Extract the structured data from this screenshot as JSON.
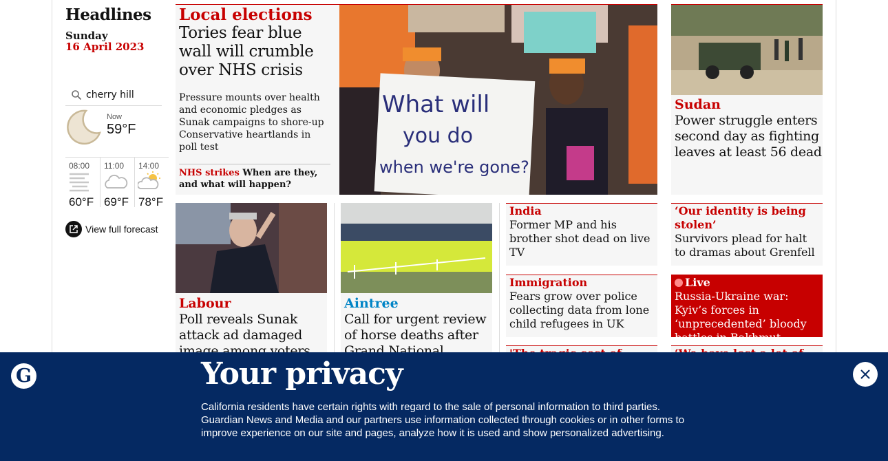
{
  "sidebar": {
    "title": "Headlines",
    "date_day": "Sunday",
    "date_full": "16 April 2023",
    "location": "cherry hill",
    "weather_now": {
      "label": "Now",
      "temp": "59°F",
      "icon": "moon-icon"
    },
    "forecast": [
      {
        "time": "08:00",
        "temp": "60°F",
        "icon": "fog-icon"
      },
      {
        "time": "11:00",
        "temp": "69°F",
        "icon": "cloud-icon"
      },
      {
        "time": "14:00",
        "temp": "78°F",
        "icon": "sun-cloud-icon"
      }
    ],
    "view_forecast_label": "View full forecast"
  },
  "top_story": {
    "kicker": "Local elections",
    "headline": "Tories fear blue wall will crumble over NHS crisis",
    "standfirst": "Pressure mounts over health and economic pledges as Sunak campaigns to shore-up Conservative heartlands in poll test",
    "sublink_kicker": "NHS strikes",
    "sublink_headline": "When are they, and what will happen?",
    "image_sign_text": [
      "What will",
      "you do",
      "when we're gone?"
    ]
  },
  "sudan": {
    "kicker": "Sudan",
    "headline": "Power struggle enters second day as fighting leaves at least 56 dead"
  },
  "labour": {
    "kicker": "Labour",
    "headline": "Poll reveals Sunak attack ad damaged image among voters"
  },
  "aintree": {
    "kicker": "Aintree",
    "headline": "Call for urgent review of horse deaths after Grand National protest"
  },
  "india": {
    "kicker": "India",
    "headline": "Former MP and his brother shot dead on live TV"
  },
  "immigration": {
    "kicker": "Immigration",
    "headline": "Fears grow over police collecting data from lone child refugees in UK"
  },
  "tragic": {
    "kicker": "'The tragic cost of under"
  },
  "identity": {
    "kicker": "‘Our identity is being stolen’",
    "headline": "Survivors plead for halt to dramas about Grenfell"
  },
  "live": {
    "kicker": "Live",
    "headline": "Russia-Ukraine war: Kyiv’s forces in ‘unprecedented’ bloody battles in Bakhmut"
  },
  "lost": {
    "kicker": "‘We have lost a lot of"
  },
  "privacy": {
    "title": "Your privacy",
    "text": "California residents have certain rights with regard to the sale of personal information to third parties. Guardian News and Media and our partners use information collected through cookies or in other forms to improve experience on our site and pages, analyze how it is used and show personalized advertising.",
    "logo_letter": "G"
  },
  "colors": {
    "news_red": "#c70000",
    "sport_blue": "#0084c6",
    "brand_blue": "#052962"
  }
}
